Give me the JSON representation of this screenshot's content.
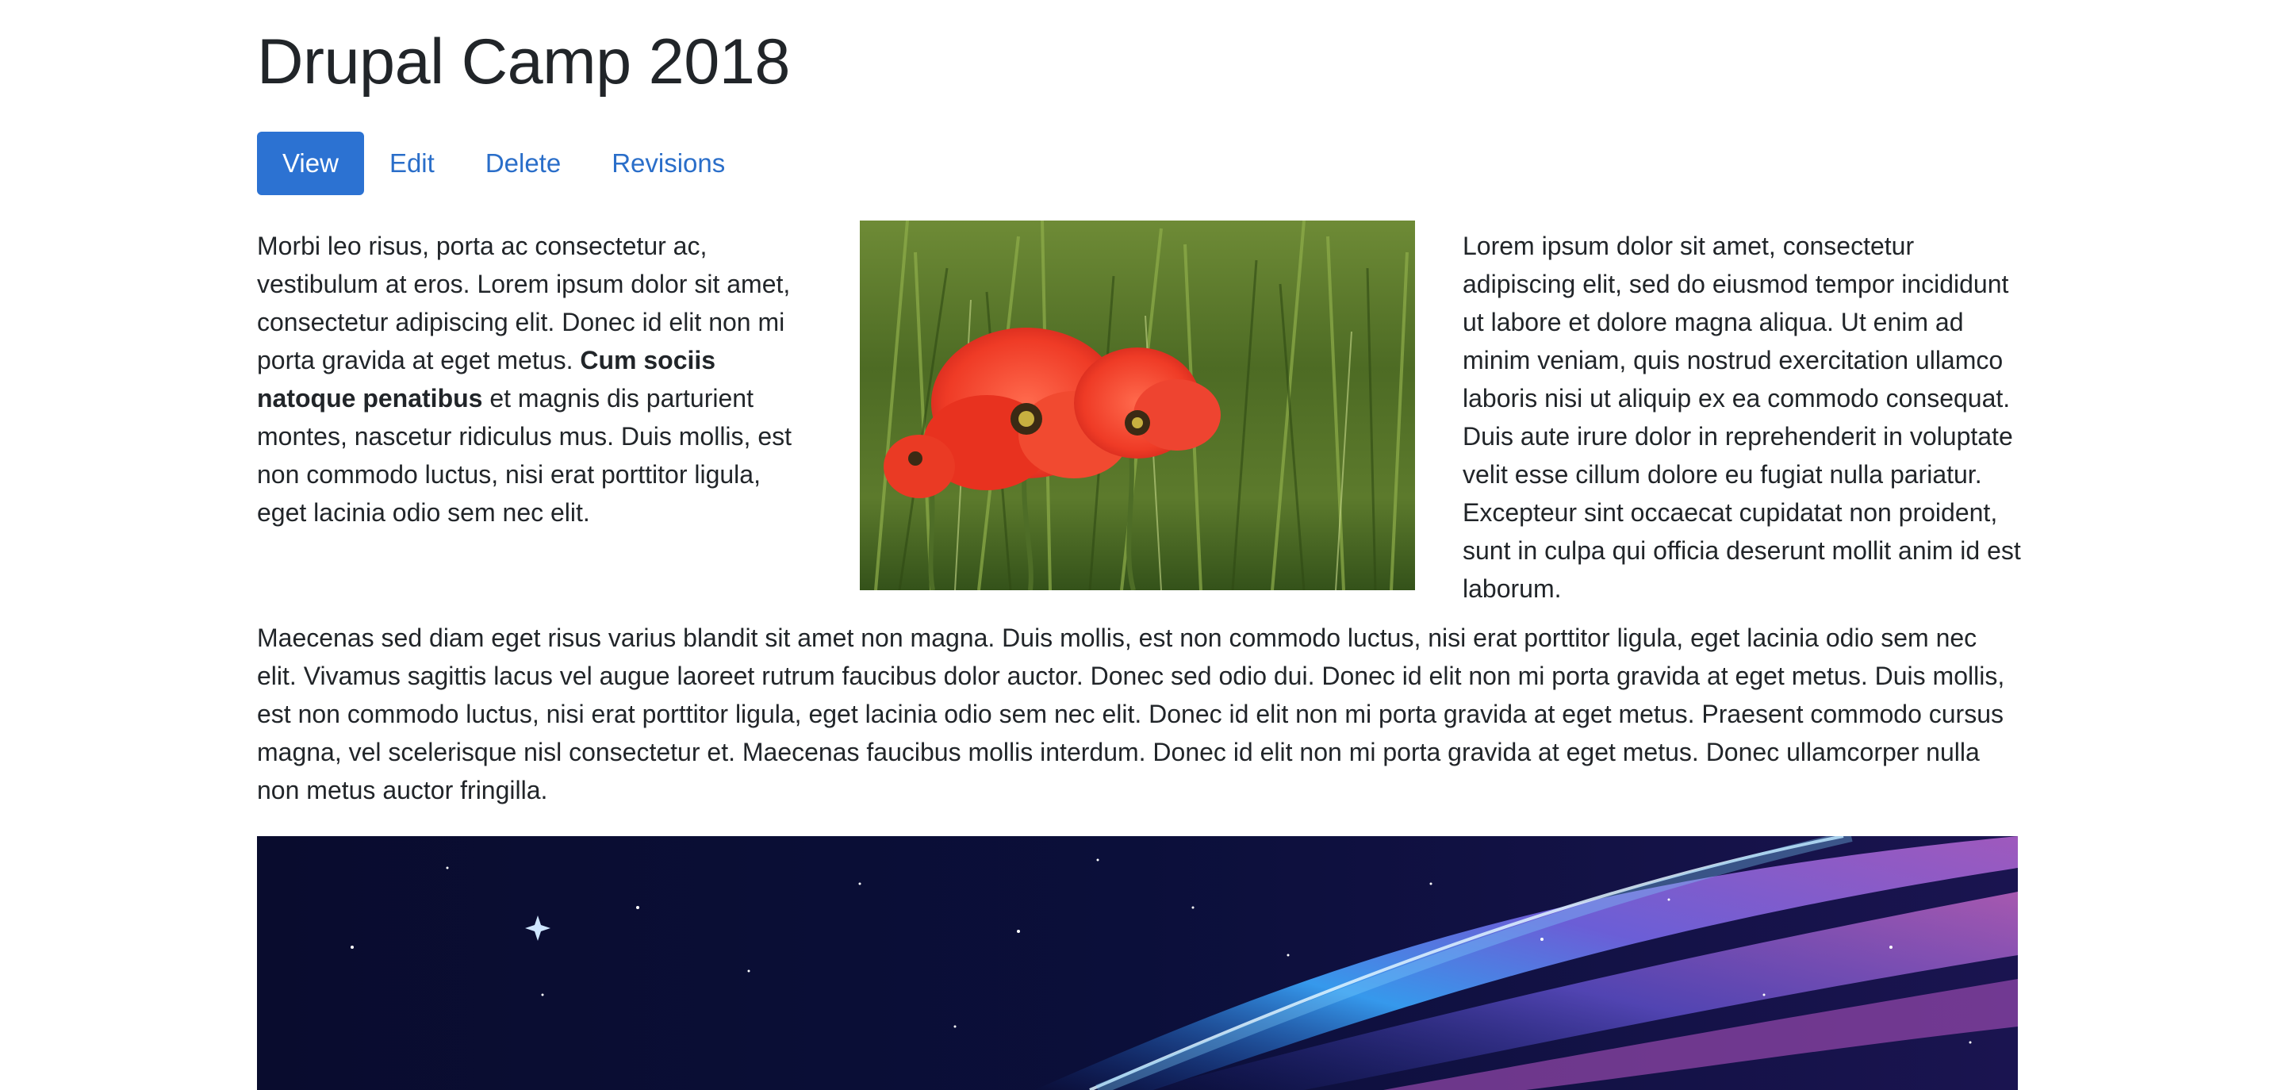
{
  "page": {
    "title": "Drupal Camp 2018"
  },
  "tabs": [
    {
      "label": "View",
      "active": true
    },
    {
      "label": "Edit",
      "active": false
    },
    {
      "label": "Delete",
      "active": false
    },
    {
      "label": "Revisions",
      "active": false
    }
  ],
  "left_column": {
    "text_before_bold": "Morbi leo risus, porta ac consectetur ac, vestibulum at eros. Lorem ipsum dolor sit amet, consectetur adipiscing elit. Donec id elit non mi porta gravida at eget metus. ",
    "bold_text": "Cum sociis natoque penatibus",
    "text_after_bold": " et magnis dis parturient montes, nascetur ridiculus mus. Duis mollis, est non commodo luctus, nisi erat porttitor ligula, eget lacinia odio sem nec elit."
  },
  "right_column": {
    "text": "Lorem ipsum dolor sit amet, consectetur adipiscing elit, sed do eiusmod tempor incididunt ut labore et dolore magna aliqua. Ut enim ad minim veniam, quis nostrud exercitation ullamco laboris nisi ut aliquip ex ea commodo consequat. Duis aute irure dolor in reprehenderit in voluptate velit esse cillum dolore eu fugiat nulla pariatur. Excepteur sint occaecat cupidatat non proident, sunt in culpa qui officia deserunt mollit anim id est laborum."
  },
  "body_paragraph": {
    "text": "Maecenas sed diam eget risus varius blandit sit amet non magna. Duis mollis, est non commodo luctus, nisi erat porttitor ligula, eget lacinia odio sem nec elit. Vivamus sagittis lacus vel augue laoreet rutrum faucibus dolor auctor. Donec sed odio dui. Donec id elit non mi porta gravida at eget metus. Duis mollis, est non commodo luctus, nisi erat porttitor ligula, eget lacinia odio sem nec elit. Donec id elit non mi porta gravida at eget metus. Praesent commodo cursus magna, vel scelerisque nisl consectetur et. Maecenas faucibus mollis interdum. Donec id elit non mi porta gravida at eget metus. Donec ullamcorper nulla non metus auctor fringilla."
  },
  "colors": {
    "active_tab_bg": "#2c72d2",
    "link": "#2a6ec9",
    "text": "#212529"
  }
}
